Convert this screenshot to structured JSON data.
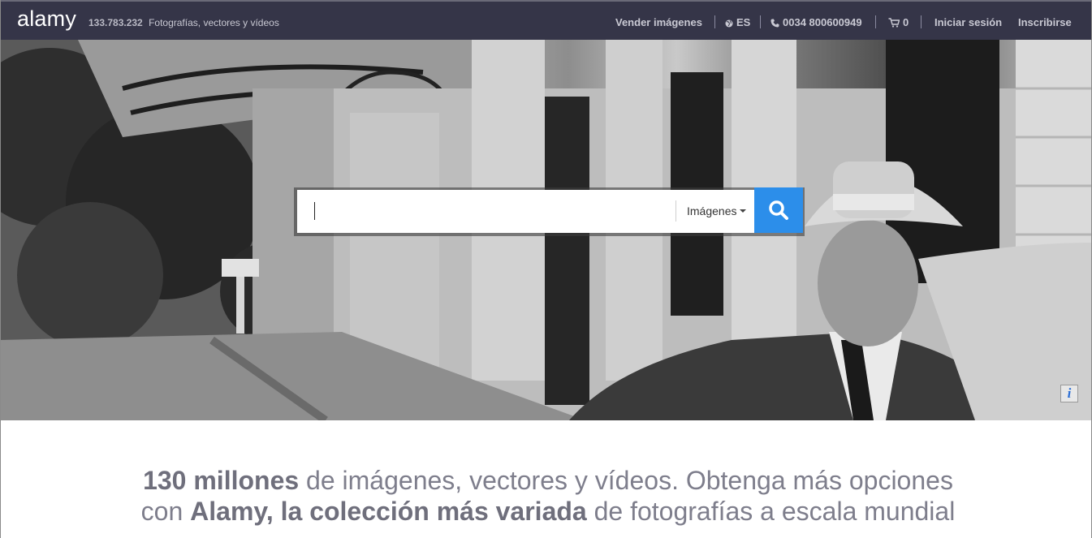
{
  "header": {
    "logo": "alamy",
    "image_count": "133.783.232",
    "tagline": "Fotografías, vectores y vídeos",
    "nav": {
      "sell": "Vender imágenes",
      "language": "ES",
      "phone": "0034 800600949",
      "cart_count": "0",
      "login": "Iniciar sesión",
      "signup": "Inscribirse"
    }
  },
  "search": {
    "value": "",
    "type_label": "Imágenes"
  },
  "hero": {
    "info_label": "i"
  },
  "headline": {
    "part1_bold": "130 millones",
    "part2": " de imágenes, vectores y vídeos. Obtenga más opciones con ",
    "part3_bold": "Alamy, la colección más variada",
    "part4": " de fotografías a escala mundial"
  },
  "icons": {
    "globe": "globe-icon",
    "phone": "phone-icon",
    "cart": "cart-icon",
    "search": "magnifier-icon",
    "info": "info-icon"
  },
  "colors": {
    "header_bg": "#353548",
    "search_button": "#2c8eea",
    "headline_text": "#7e7e8c"
  }
}
